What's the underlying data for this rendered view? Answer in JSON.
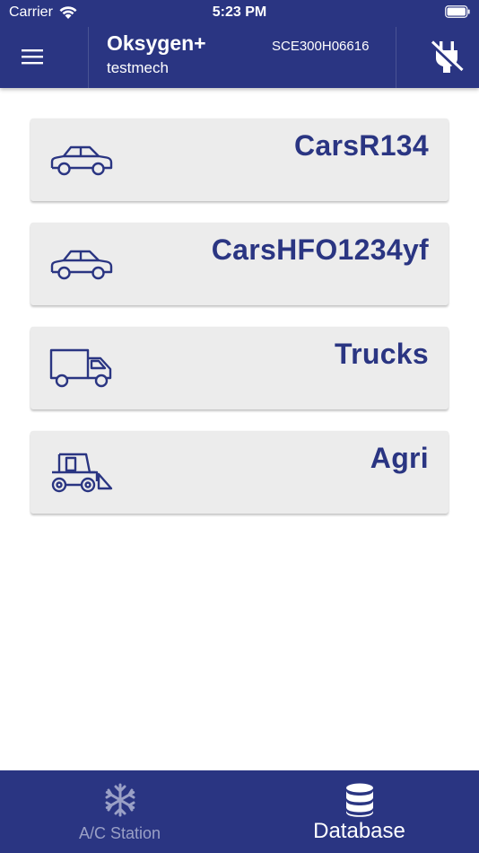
{
  "status_bar": {
    "carrier": "Carrier",
    "time": "5:23 PM",
    "wifi_icon": "wifi-icon",
    "battery_icon": "battery-icon"
  },
  "header": {
    "menu_icon": "hamburger-menu-icon",
    "title": "Oksygen+",
    "user": "testmech",
    "device_id": "SCE300H06616",
    "connection_icon": "unplugged-icon",
    "background_color": "#2a3582"
  },
  "categories": [
    {
      "label": "CarsR134",
      "icon": "car-icon"
    },
    {
      "label": "CarsHFO1234yf",
      "icon": "car-icon"
    },
    {
      "label": "Trucks",
      "icon": "truck-icon"
    },
    {
      "label": "Agri",
      "icon": "tractor-icon"
    }
  ],
  "tab_bar": {
    "tabs": [
      {
        "label": "A/C Station",
        "icon": "snowflake-icon",
        "active": false
      },
      {
        "label": "Database",
        "icon": "database-icon",
        "active": true
      }
    ]
  },
  "colors": {
    "accent": "#2a3582",
    "card_background": "#ececec",
    "inactive_tab": "#9aa0c6"
  }
}
